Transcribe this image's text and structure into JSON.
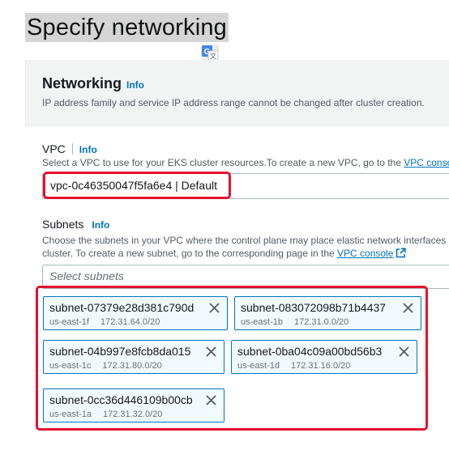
{
  "page": {
    "title": "Specify networking"
  },
  "networking": {
    "title": "Networking",
    "info": "Info",
    "description": "IP address family and service IP address range cannot be changed after cluster creation."
  },
  "vpc": {
    "label": "VPC",
    "info": "Info",
    "description": "Select a VPC to use for your EKS cluster resources.To create a new VPC, go to the",
    "link": "VPC console",
    "value": "vpc-0c46350047f5fa6e4 | Default"
  },
  "subnets": {
    "label": "Subnets",
    "info": "Info",
    "description_line1": "Choose the subnets in your VPC where the control plane may place elastic network interfaces",
    "description_line2": "cluster. To create a new subnet, go to the corresponding page in the",
    "link": "VPC console",
    "placeholder": "Select subnets",
    "selected": [
      {
        "id": "subnet-07379e28d381c790d",
        "az": "us-east-1f",
        "cidr": "172.31.64.0/20"
      },
      {
        "id": "subnet-083072098b71b4437",
        "az": "us-east-1b",
        "cidr": "172.31.0.0/20"
      },
      {
        "id": "subnet-04b997e8fcb8da015",
        "az": "us-east-1c",
        "cidr": "172.31.80.0/20"
      },
      {
        "id": "subnet-0ba04c09a00bd56b3",
        "az": "us-east-1d",
        "cidr": "172.31.16.0/20"
      },
      {
        "id": "subnet-0cc36d446109b00cb",
        "az": "us-east-1a",
        "cidr": "172.31.32.0/20"
      }
    ]
  },
  "colors": {
    "accent": "#0073bb",
    "highlight": "#e4112f",
    "token_bg": "#f1faff"
  },
  "icons": {
    "translate": "google-translate-icon",
    "external": "external-link-icon",
    "remove": "close-icon"
  }
}
